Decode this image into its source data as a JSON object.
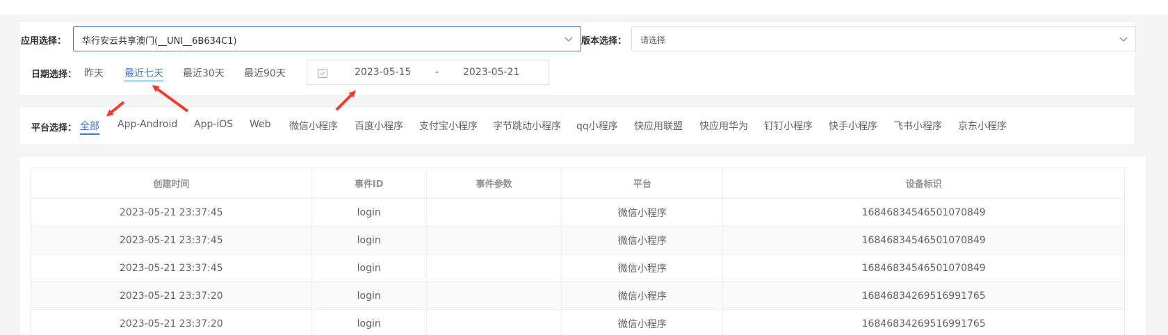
{
  "filters": {
    "app_label": "应用选择：",
    "app_value": "华行安云共享澳门(__UNI__6B634C1)",
    "version_label": "版本选择：",
    "version_placeholder": "请选择",
    "date_label": "日期选择：",
    "date_options": [
      "昨天",
      "最近七天",
      "最近30天",
      "最近90天"
    ],
    "date_active": "最近七天",
    "date_start": "2023-05-15",
    "date_end": "2023-05-21",
    "date_separator": "-"
  },
  "platform": {
    "label": "平台选择：",
    "options": [
      "全部",
      "App-Android",
      "App-iOS",
      "Web",
      "微信小程序",
      "百度小程序",
      "支付宝小程序",
      "字节跳动小程序",
      "qq小程序",
      "快应用联盟",
      "快应用华为",
      "钉钉小程序",
      "快手小程序",
      "飞书小程序",
      "京东小程序"
    ],
    "active": "全部"
  },
  "table": {
    "headers": [
      "创建时间",
      "事件ID",
      "事件参数",
      "平台",
      "设备标识"
    ],
    "rows": [
      [
        "2023-05-21 23:37:45",
        "login",
        "",
        "微信小程序",
        "16846834546501070849"
      ],
      [
        "2023-05-21 23:37:45",
        "login",
        "",
        "微信小程序",
        "16846834546501070849"
      ],
      [
        "2023-05-21 23:37:45",
        "login",
        "",
        "微信小程序",
        "16846834546501070849"
      ],
      [
        "2023-05-21 23:37:20",
        "login",
        "",
        "微信小程序",
        "16846834269516991765"
      ],
      [
        "2023-05-21 23:37:20",
        "login",
        "",
        "微信小程序",
        "16846834269516991765"
      ]
    ]
  },
  "colors": {
    "accent": "#3a7bd5",
    "annotation_arrow": "#f03c2e"
  }
}
